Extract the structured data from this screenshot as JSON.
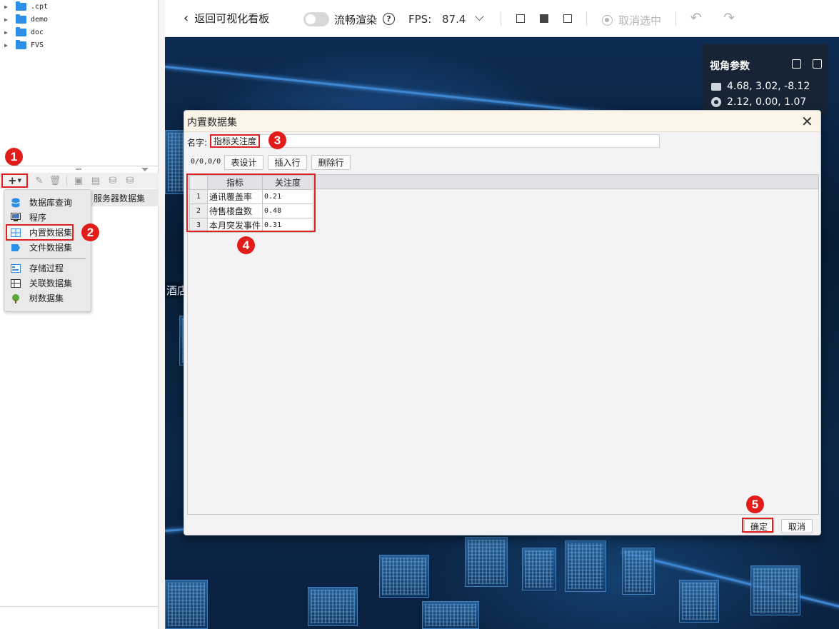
{
  "file_tree": [
    {
      "name": ".cpt"
    },
    {
      "name": "demo"
    },
    {
      "name": "doc"
    },
    {
      "name": "FVS"
    }
  ],
  "dataset_panel": {
    "server_dataset_header": "服务器数据集"
  },
  "add_menu": [
    {
      "label": "数据库查询",
      "icon": "database-icon"
    },
    {
      "label": "程序",
      "icon": "program-icon"
    },
    {
      "label": "内置数据集",
      "icon": "builtin-dataset-icon"
    },
    {
      "label": "文件数据集",
      "icon": "file-dataset-icon"
    },
    {
      "label": "存储过程",
      "icon": "stored-procedure-icon"
    },
    {
      "label": "关联数据集",
      "icon": "join-dataset-icon"
    },
    {
      "label": "树数据集",
      "icon": "tree-dataset-icon"
    }
  ],
  "badges": [
    "1",
    "2",
    "3",
    "4",
    "5"
  ],
  "toolbar": {
    "back_label": "返回可视化看板",
    "smooth_render_label": "流畅渲染",
    "fps_label": "FPS:",
    "fps_value": "87.4",
    "cancel_select_label": "取消选中"
  },
  "view_params": {
    "title": "视角参数",
    "camera": "4.68, 3.02, -8.12",
    "target": "2.12, 0.00, 1.07"
  },
  "scene": {
    "label": "酒店"
  },
  "dialog": {
    "title": "内置数据集",
    "name_label": "名字:",
    "name_value": "指标关注度",
    "position": "0/0,0/0",
    "btn_design": "表设计",
    "btn_insert": "插入行",
    "btn_delete": "删除行",
    "columns": [
      "指标",
      "关注度"
    ],
    "rows": [
      {
        "n": "1",
        "c1": "通讯覆盖率",
        "c2": "0.21"
      },
      {
        "n": "2",
        "c1": "待售楼盘数",
        "c2": "0.48"
      },
      {
        "n": "3",
        "c1": "本月突发事件",
        "c2": "0.31"
      }
    ],
    "ok_label": "确定",
    "cancel_label": "取消"
  },
  "colors": {
    "annotation_red": "#e21b1b",
    "folder_blue": "#2e8fe6",
    "scene_dark": "#081c36"
  }
}
